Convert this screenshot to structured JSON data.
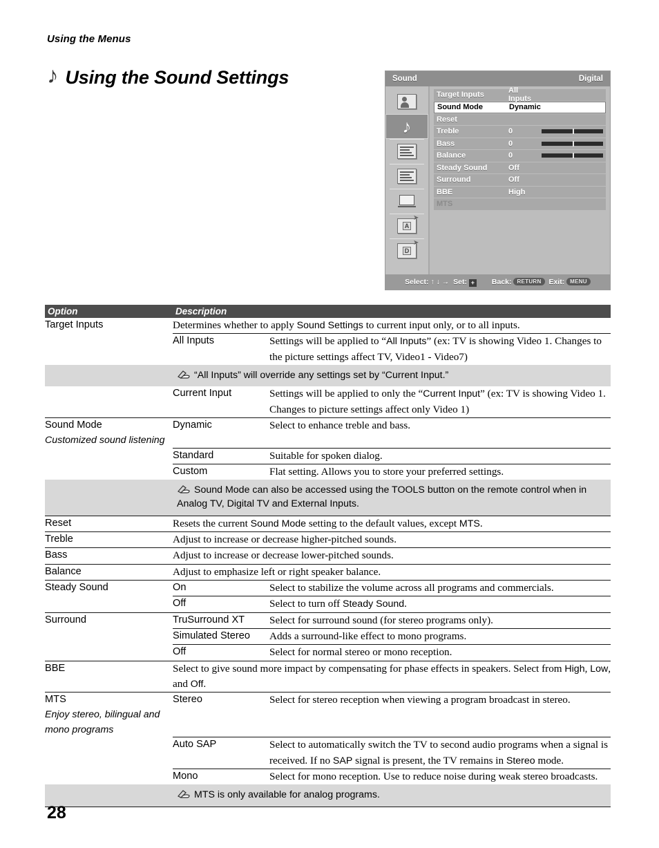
{
  "running_head": "Using the Menus",
  "page_title": "Using the Sound Settings",
  "page_number": "28",
  "osd": {
    "title": "Sound",
    "source": "Digital",
    "rail": [
      {
        "name": "picture-icon"
      },
      {
        "name": "sound-icon"
      },
      {
        "name": "channel-icon"
      },
      {
        "name": "settings-icon"
      },
      {
        "name": "screen-icon"
      },
      {
        "name": "analog-setup-icon"
      },
      {
        "name": "digital-setup-icon"
      }
    ],
    "rows": [
      {
        "label": "Target Inputs",
        "value": "All Inputs",
        "state": "normal",
        "slider": false
      },
      {
        "label": "Sound Mode",
        "value": "Dynamic",
        "state": "selected",
        "slider": false
      },
      {
        "label": "Reset",
        "value": "",
        "state": "normal",
        "slider": false
      },
      {
        "label": "Treble",
        "value": "0",
        "state": "normal",
        "slider": true
      },
      {
        "label": "Bass",
        "value": "0",
        "state": "normal",
        "slider": true
      },
      {
        "label": "Balance",
        "value": "0",
        "state": "normal",
        "slider": true
      },
      {
        "label": "Steady Sound",
        "value": "Off",
        "state": "normal",
        "slider": false
      },
      {
        "label": "Surround",
        "value": "Off",
        "state": "normal",
        "slider": false
      },
      {
        "label": "BBE",
        "value": "High",
        "state": "normal",
        "slider": false
      },
      {
        "label": "MTS",
        "value": "",
        "state": "dim",
        "slider": false
      }
    ],
    "footer": {
      "select_label": "Select:",
      "select_keys": "↑ ↓ →",
      "set_label": "Set:",
      "set_key": "+",
      "back_label": "Back:",
      "back_key": "RETURN",
      "exit_label": "Exit:",
      "exit_key": "MENU"
    }
  },
  "table": {
    "header": {
      "option": "Option",
      "description": "Description"
    },
    "rows": [
      {
        "option": "Target Inputs",
        "option_italic": "",
        "sub": "",
        "desc_pre": "Determines whether to apply ",
        "desc_sans": "Sound Settings",
        "desc_post": " to current input only, or to all inputs.",
        "span_desc": true
      },
      {
        "option": "",
        "sub": "All Inputs",
        "desc_pre": "Settings will be applied to “",
        "desc_sans": "All Inputs",
        "desc_post": "” (ex: TV is showing Video 1. Changes to the picture settings affect TV, Video1 - Video7)"
      },
      {
        "note": "“All Inputs” will override any settings set by “Current Input.”"
      },
      {
        "option": "",
        "sub": "Current Input",
        "desc_pre": "Settings will be applied to only the “",
        "desc_sans": "Current Input",
        "desc_post": "” (ex: TV is showing Video 1.  Changes to picture settings affect only Video 1)"
      },
      {
        "option": "Sound Mode",
        "option_italic": "Customized sound listening",
        "sub": "Dynamic",
        "desc_pre": "Select to enhance treble and bass.",
        "desc_sans": "",
        "desc_post": ""
      },
      {
        "option": "",
        "sub": "Standard",
        "desc_pre": "Suitable for spoken dialog.",
        "desc_sans": "",
        "desc_post": ""
      },
      {
        "option": "",
        "sub": "Custom",
        "desc_pre": "Flat setting. Allows you to store your preferred settings.",
        "desc_sans": "",
        "desc_post": ""
      },
      {
        "note": "Sound Mode can also be accessed using the TOOLS button on the remote control when in Analog TV, Digital TV and External Inputs."
      },
      {
        "option": "Reset",
        "sub": "",
        "desc_pre": "Resets the current ",
        "desc_sans": "Sound Mode",
        "desc_post": " setting to the default values, except ",
        "desc_sans2": "MTS",
        "desc_post2": ".",
        "span_desc": true
      },
      {
        "option": "Treble",
        "sub": "",
        "desc_pre": "Adjust to increase or decrease higher-pitched sounds.",
        "span_desc": true
      },
      {
        "option": "Bass",
        "sub": "",
        "desc_pre": "Adjust to increase or decrease lower-pitched sounds.",
        "span_desc": true
      },
      {
        "option": "Balance",
        "sub": "",
        "desc_pre": "Adjust to emphasize left or right speaker balance.",
        "span_desc": true
      },
      {
        "option": "Steady Sound",
        "sub": "On",
        "desc_pre": "Select to stabilize the volume across all programs and commercials.",
        "desc_sans": "",
        "desc_post": ""
      },
      {
        "option": "",
        "sub": "Off",
        "desc_pre": "Select to turn off ",
        "desc_sans": "Steady Sound",
        "desc_post": "."
      },
      {
        "option": "Surround",
        "sub": "TruSurround XT",
        "desc_pre": "Select for surround sound (for stereo programs only).",
        "desc_sans": "",
        "desc_post": ""
      },
      {
        "option": "",
        "sub": "Simulated Stereo",
        "desc_pre": "Adds a surround-like effect to mono programs.",
        "desc_sans": "",
        "desc_post": ""
      },
      {
        "option": "",
        "sub": "Off",
        "desc_pre": "Select for normal stereo or mono reception.",
        "desc_sans": "",
        "desc_post": ""
      },
      {
        "option": "BBE",
        "sub": "",
        "desc_pre": "Select to give sound more impact by compensating for phase effects in speakers. Select from ",
        "desc_sans": "High",
        "desc_post": ", ",
        "desc_sans2": "Low",
        "desc_post2": ", and ",
        "desc_sans3": "Off",
        "desc_post3": ".",
        "span_desc": true
      },
      {
        "option": "MTS",
        "option_italic": "Enjoy stereo, bilingual and mono programs",
        "sub": "Stereo",
        "desc_pre": "Select for stereo reception when viewing a program broadcast in stereo.",
        "desc_sans": "",
        "desc_post": ""
      },
      {
        "option": "",
        "sub": "Auto SAP",
        "desc_pre": "Select to automatically switch the TV to second audio programs when a signal is received. If no ",
        "desc_sans": "SAP",
        "desc_post": " signal is present, the TV remains in ",
        "desc_sans2": "Stereo",
        "desc_post2": " mode."
      },
      {
        "option": "",
        "sub": "Mono",
        "desc_pre": "Select for mono reception. Use to reduce noise during weak stereo broadcasts.",
        "desc_sans": "",
        "desc_post": ""
      },
      {
        "note": "MTS is only available for analog programs."
      }
    ]
  }
}
